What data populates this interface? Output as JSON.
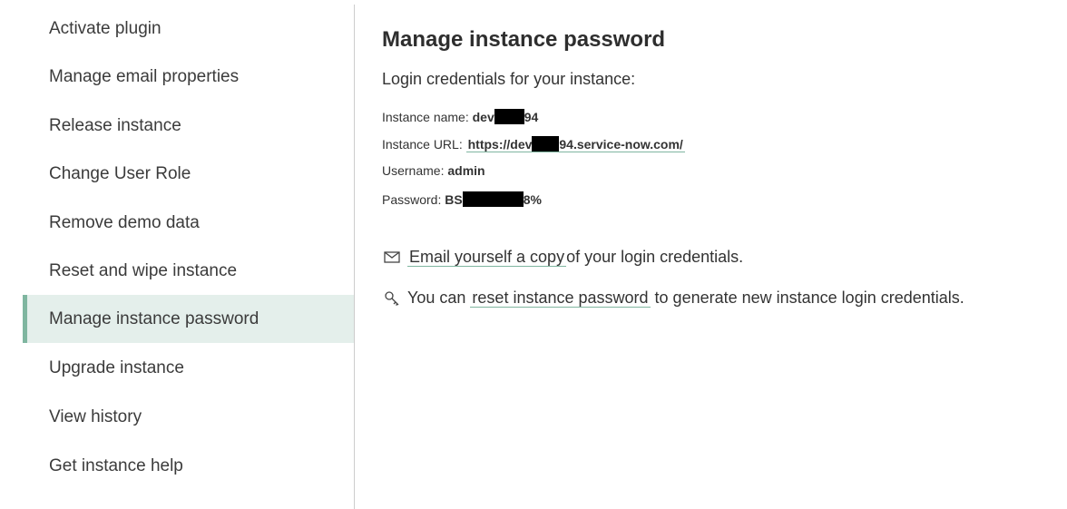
{
  "sidebar": {
    "items": [
      {
        "label": "Activate plugin"
      },
      {
        "label": "Manage email properties"
      },
      {
        "label": "Release instance"
      },
      {
        "label": "Change User Role"
      },
      {
        "label": "Remove demo data"
      },
      {
        "label": "Reset and wipe instance"
      },
      {
        "label": "Manage instance password",
        "active": true
      },
      {
        "label": "Upgrade instance"
      },
      {
        "label": "View history"
      },
      {
        "label": "Get instance help"
      }
    ]
  },
  "main": {
    "title": "Manage instance password",
    "subtitle": "Login credentials for your instance:",
    "instance_name": {
      "label": "Instance name:",
      "prefix": "dev",
      "suffix": "94"
    },
    "instance_url": {
      "label": "Instance URL:",
      "prefix": "https://dev",
      "suffix": "94.service-now.com/"
    },
    "username": {
      "label": "Username:",
      "value": "admin"
    },
    "password": {
      "label": "Password:",
      "prefix": "BS",
      "suffix": "8%"
    },
    "email": {
      "icon": "envelope-icon",
      "link": "Email yourself a copy",
      "text": "of your login credentials."
    },
    "reset": {
      "icon": "key-icon",
      "before": "You can",
      "link": "reset instance password",
      "after": "to generate new instance login credentials."
    }
  }
}
